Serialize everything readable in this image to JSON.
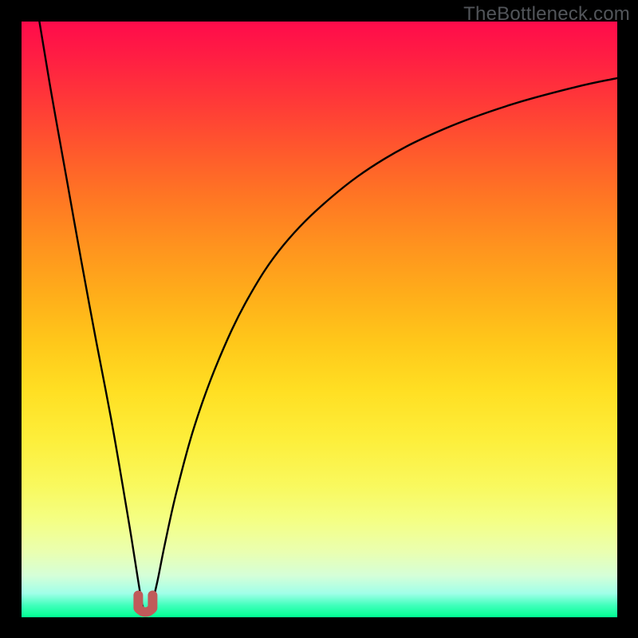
{
  "watermark": {
    "text": "TheBottleneck.com"
  },
  "chart_data": {
    "type": "line",
    "title": "",
    "xlabel": "",
    "ylabel": "",
    "xlim": [
      0,
      100
    ],
    "ylim": [
      0,
      100
    ],
    "grid": false,
    "note": "A single black curve with a sharp minimum near x≈21. Left branch drops steeply from top-left; right branch rises concavely toward upper-right. Values estimated from pixel positions (y=0 bottom, y=100 top).",
    "series": [
      {
        "name": "bottleneck-curve",
        "x": [
          3.0,
          5.0,
          7.5,
          10.0,
          12.5,
          15.0,
          17.0,
          18.5,
          19.6,
          20.3,
          21.0,
          21.8,
          22.8,
          24.0,
          26.0,
          29.0,
          33.0,
          38.0,
          44.0,
          52.0,
          61.0,
          71.0,
          82.0,
          93.0,
          100.0
        ],
        "y": [
          100.0,
          88.0,
          74.0,
          60.0,
          46.5,
          33.5,
          22.0,
          13.0,
          6.0,
          2.0,
          0.5,
          2.0,
          6.0,
          12.0,
          21.0,
          32.0,
          43.0,
          53.5,
          62.5,
          70.5,
          77.0,
          82.0,
          86.0,
          89.0,
          90.5
        ]
      }
    ],
    "marker": {
      "name": "optimum",
      "cx": 20.8,
      "cy": 1.8,
      "color": "#c05a5a",
      "note": "Small pink/red U-shaped marker at curve minimum."
    },
    "background": {
      "type": "vertical-gradient",
      "top_color": "#ff0b4b",
      "bottom_color": "#00ff92",
      "note": "Red→orange→yellow→green heat gradient fills the plot area."
    }
  }
}
